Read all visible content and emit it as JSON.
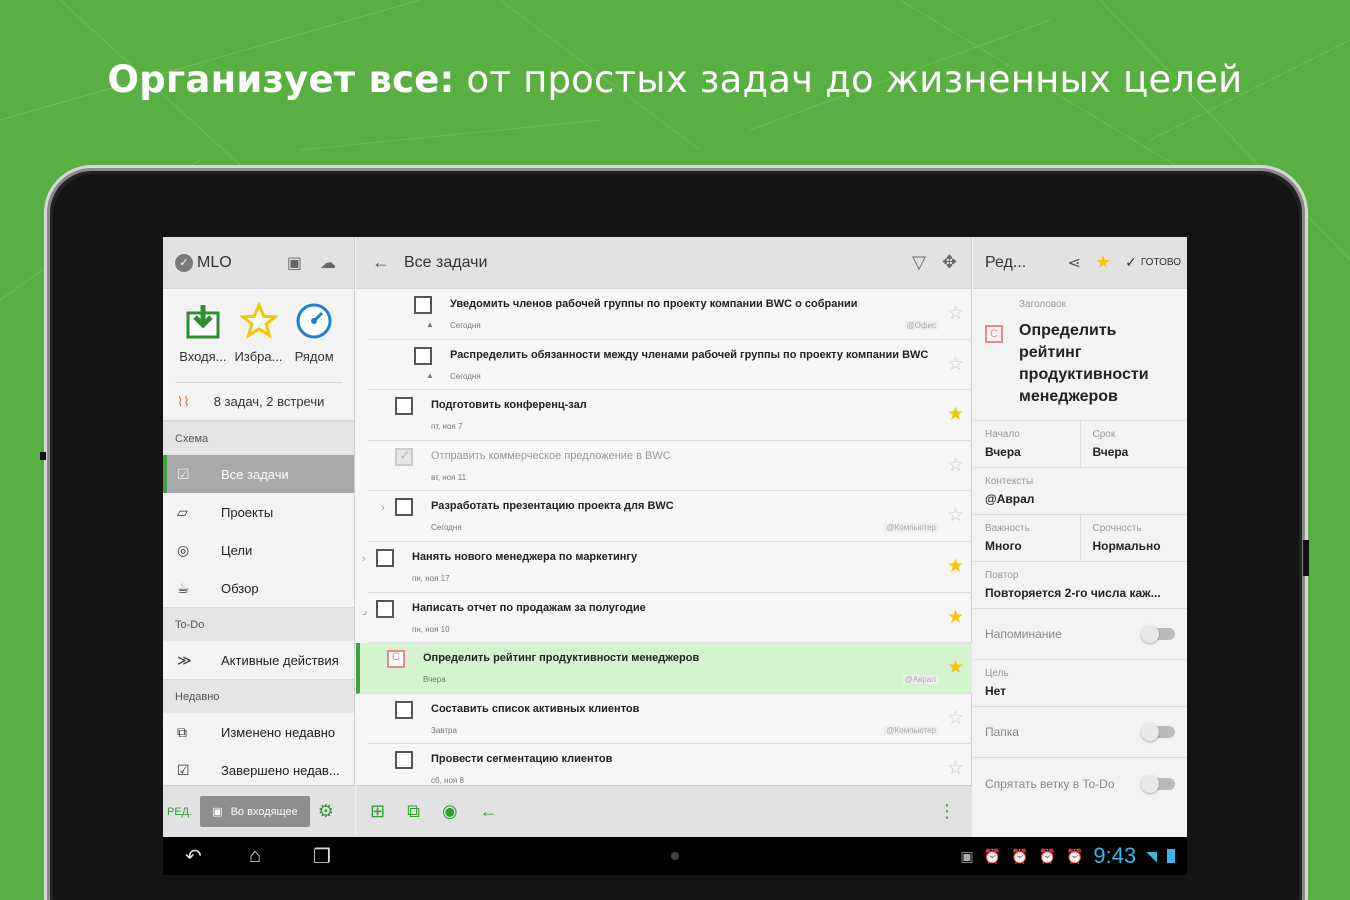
{
  "headline": {
    "bold": "Организует все:",
    "rest": " от простых задач до жизненных целей"
  },
  "left": {
    "app_name": "MLO",
    "quick": [
      {
        "label": "Входя...",
        "icon": "inbox-icon"
      },
      {
        "label": "Избра...",
        "icon": "star-icon"
      },
      {
        "label": "Рядом",
        "icon": "compass-icon"
      }
    ],
    "summary": "8 задач, 2 встречи",
    "sections": {
      "schema": "Схема",
      "todo": "To-Do",
      "recent": "Недавно"
    },
    "schema_items": [
      {
        "label": "Все задачи",
        "icon": "checklist-icon"
      },
      {
        "label": "Проекты",
        "icon": "projects-icon"
      },
      {
        "label": "Цели",
        "icon": "target-icon"
      },
      {
        "label": "Обзор",
        "icon": "review-icon"
      }
    ],
    "todo_items": [
      {
        "label": "Активные действия",
        "icon": "double-chevron-icon"
      }
    ],
    "recent_items": [
      {
        "label": "Изменено недавно",
        "icon": "copy-icon"
      },
      {
        "label": "Завершено недав...",
        "icon": "checkbox-icon"
      }
    ],
    "edit_label": "РЕД.",
    "inbox_button": "Во входящее"
  },
  "mid": {
    "title": "Все задачи",
    "tasks": [
      {
        "title": "Уведомить членов рабочей группы по проекту компании BWC о собрании",
        "sub": "Сегодня",
        "ctx": "@Офис",
        "star": false,
        "indent": 2,
        "bell": true
      },
      {
        "title": "Распределить обязанности между членами рабочей группы по проекту компании BWC",
        "sub": "Сегодня",
        "ctx": "",
        "star": false,
        "indent": 2,
        "bell": true
      },
      {
        "title": "Подготовить конференц-зал",
        "sub": "пт, ноя 7",
        "ctx": "",
        "star": true,
        "indent": 1
      },
      {
        "title": "Отправить коммерческое предложение в BWC",
        "sub": "вт, ноя 11",
        "ctx": "",
        "star": false,
        "indent": 1,
        "done": true
      },
      {
        "title": "Разработать презентацию проекта для BWC",
        "sub": "Сегодня",
        "ctx": "@Компьютер",
        "star": false,
        "indent": 1,
        "arrow": "›"
      },
      {
        "title": "Нанять нового менеджера по маркетингу",
        "sub": "пн, ноя 17",
        "ctx": "",
        "star": true,
        "indent": 0,
        "arrow": "›"
      },
      {
        "title": "Написать отчет по продажам за полугодие",
        "sub": "пн, ноя 10",
        "ctx": "",
        "star": true,
        "indent": 0,
        "arrow": "⌟"
      },
      {
        "title": "Определить рейтинг продуктивности менеджеров",
        "sub": "Вчера",
        "ctx": "@Аврал",
        "star": true,
        "indent": 1,
        "goal": true,
        "selected": true
      },
      {
        "title": "Составить список активных клиентов",
        "sub": "Завтра",
        "ctx": "@Компьютер",
        "star": false,
        "indent": 1
      },
      {
        "title": "Провести сегментацию клиентов",
        "sub": "сб, ноя 8",
        "ctx": "",
        "star": false,
        "indent": 1
      }
    ]
  },
  "right": {
    "title": "Ред...",
    "done_label": "ГОТОВО",
    "heading_label": "Заголовок",
    "heading": "Определить рейтинг продуктивности менеджеров",
    "start_label": "Начало",
    "start": "Вчера",
    "due_label": "Срок",
    "due": "Вчера",
    "contexts_label": "Контексты",
    "contexts": "@Аврал",
    "importance_label": "Важность",
    "importance": "Много",
    "urgency_label": "Срочность",
    "urgency": "Нормально",
    "repeat_label": "Повтор",
    "repeat": "Повторяется 2-го числа каж...",
    "reminder_label": "Напоминание",
    "goal_label": "Цель",
    "goal": "Нет",
    "folder_label": "Папка",
    "hide_label": "Спрятать ветку в To-Do"
  },
  "status": {
    "time": "9:43"
  },
  "colors": {
    "accent": "#3ea33e",
    "star": "#f6c40e",
    "selected_row": "#d4f4cf",
    "background": "#5aaf43"
  }
}
